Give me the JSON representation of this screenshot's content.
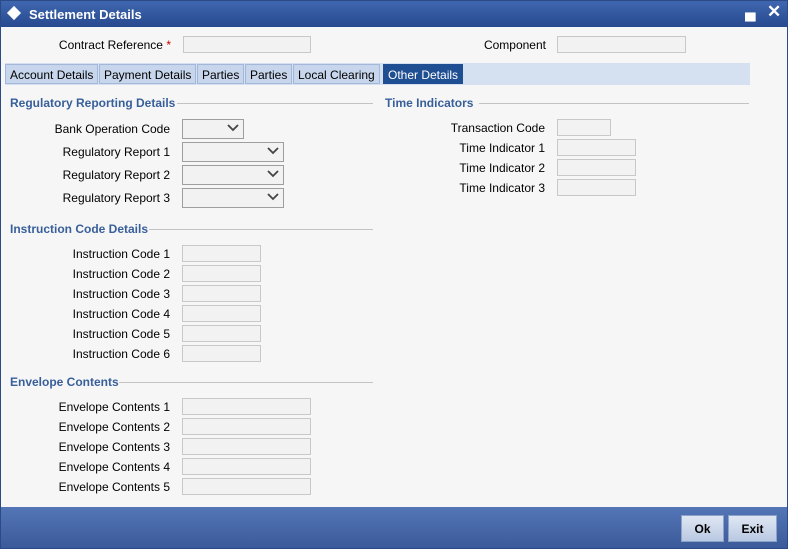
{
  "window": {
    "title": "Settlement Details"
  },
  "header": {
    "contract_reference_label": "Contract Reference",
    "required_mark": "*",
    "contract_reference_value": "",
    "component_label": "Component",
    "component_value": ""
  },
  "tabs": [
    {
      "label": "Account Details"
    },
    {
      "label": "Payment Details"
    },
    {
      "label": "Parties"
    },
    {
      "label": "Parties"
    },
    {
      "label": "Local Clearing"
    },
    {
      "label": "Other Details",
      "active": true
    }
  ],
  "regulatory": {
    "title": "Regulatory Reporting Details",
    "bank_operation_code_label": "Bank Operation Code",
    "bank_operation_code_value": "",
    "report1_label": "Regulatory Report 1",
    "report2_label": "Regulatory Report 2",
    "report3_label": "Regulatory Report 3"
  },
  "instruction": {
    "title": "Instruction Code Details",
    "labels": [
      "Instruction Code 1",
      "Instruction Code 2",
      "Instruction Code 3",
      "Instruction Code 4",
      "Instruction Code 5",
      "Instruction Code 6"
    ]
  },
  "envelope": {
    "title": "Envelope Contents",
    "labels": [
      "Envelope Contents 1",
      "Envelope Contents 2",
      "Envelope Contents 3",
      "Envelope Contents 4",
      "Envelope Contents 5"
    ]
  },
  "time": {
    "title": "Time Indicators",
    "transaction_code_label": "Transaction Code",
    "labels": [
      "Time Indicator 1",
      "Time Indicator 2",
      "Time Indicator 3"
    ]
  },
  "footer": {
    "ok_label": "Ok",
    "exit_label": "Exit"
  },
  "colors": {
    "titlebar": "#27498f",
    "active_tab": "#1f4e93",
    "section_title": "#385f9a",
    "required": "#cc0000"
  },
  "icons": {
    "title": "diamond-icon",
    "minimize": "minimize-icon",
    "close": "close-icon",
    "dropdown": "chevron-down-icon"
  }
}
